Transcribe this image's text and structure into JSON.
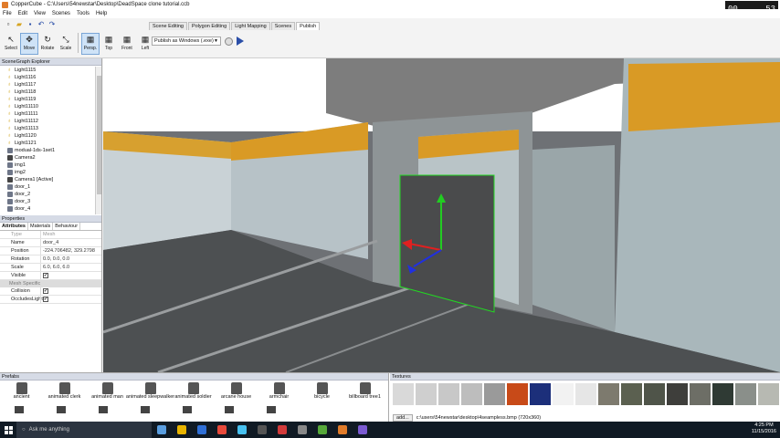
{
  "window": {
    "title": "CopperCube - C:\\Users\\54newstar\\Desktop\\DeadSpace clone tutorial.ccb"
  },
  "menu": [
    "File",
    "Edit",
    "View",
    "Scenes",
    "Tools",
    "Help"
  ],
  "clock_widget": {
    "left": "00",
    "right": "53"
  },
  "tools": [
    {
      "label": "Select",
      "icon": "↖"
    },
    {
      "label": "Move",
      "icon": "✥"
    },
    {
      "label": "Rotate",
      "icon": "↻"
    },
    {
      "label": "Scale",
      "icon": "⤡"
    }
  ],
  "views": [
    {
      "label": "Persp."
    },
    {
      "label": "Top"
    },
    {
      "label": "Front"
    },
    {
      "label": "Left"
    }
  ],
  "ribbon_tabs": [
    "Scene Editing",
    "Polygon Editing",
    "Light Mapping",
    "Scenes",
    "Publish"
  ],
  "active_ribbon_tab": "Publish",
  "publish_target": "Publish as Windows (.exe)",
  "scenegraph": {
    "title": "SceneGraph Explorer",
    "items": [
      {
        "label": "Light1115",
        "kind": "light"
      },
      {
        "label": "Light1116",
        "kind": "light"
      },
      {
        "label": "Light1117",
        "kind": "light"
      },
      {
        "label": "Light1118",
        "kind": "light"
      },
      {
        "label": "Light1119",
        "kind": "light"
      },
      {
        "label": "Light11110",
        "kind": "light"
      },
      {
        "label": "Light11111",
        "kind": "light"
      },
      {
        "label": "Light11112",
        "kind": "light"
      },
      {
        "label": "Light11113",
        "kind": "light"
      },
      {
        "label": "Light1120",
        "kind": "light"
      },
      {
        "label": "Light1121",
        "kind": "light"
      },
      {
        "label": "modual-1ds-1set1",
        "kind": "mesh"
      },
      {
        "label": "Camera2",
        "kind": "cam"
      },
      {
        "label": "img1",
        "kind": "mesh"
      },
      {
        "label": "img2",
        "kind": "mesh"
      },
      {
        "label": "Camera1 [Active]",
        "kind": "cam"
      },
      {
        "label": "door_1",
        "kind": "mesh"
      },
      {
        "label": "door_2",
        "kind": "mesh"
      },
      {
        "label": "door_3",
        "kind": "mesh"
      },
      {
        "label": "door_4",
        "kind": "mesh"
      }
    ]
  },
  "properties": {
    "title": "Properties",
    "tabs": [
      "Attributes",
      "Materials",
      "Behaviour"
    ],
    "rows": [
      {
        "key": "Type",
        "value": "Mesh",
        "dim": true
      },
      {
        "key": "Name",
        "value": "door_4"
      },
      {
        "key": "Position",
        "value": "-224.706482, 329.2798"
      },
      {
        "key": "Rotation",
        "value": "0.0, 0.0, 0.0"
      },
      {
        "key": "Scale",
        "value": "6.0, 6.0, 6.0"
      },
      {
        "key": "Visible",
        "value": "✔",
        "check": true
      }
    ],
    "section": "Mesh Specific",
    "section_rows": [
      {
        "key": "Collision",
        "value": "✔",
        "check": true
      },
      {
        "key": "OccludesLight",
        "value": "✔",
        "check": true
      }
    ]
  },
  "prefabs": {
    "title": "Prefabs",
    "items": [
      "ancient",
      "animated clerk",
      "animated man",
      "animated sleepwalker",
      "animated soldier",
      "arcane house",
      "armchair",
      "bicycle",
      "billboard tree1"
    ]
  },
  "textures": {
    "title": "Textures",
    "add_label": "add...",
    "path": "c:\\users\\54newstar\\desktop\\4seampless.bmp (720x360)",
    "swatches": [
      "#d9d9d9",
      "#cfcfcf",
      "#c8c8c8",
      "#bdbdbd",
      "#9a9a9a",
      "#c84a18",
      "#1c2f7a",
      "#f2f2f2",
      "#e6e6e6",
      "#7d7a6e",
      "#5b6050",
      "#4f5449",
      "#3e3e3b",
      "#6d6e66",
      "#2f3a34",
      "#8a8f8a",
      "#b7b9b2"
    ]
  },
  "taskbar": {
    "search_placeholder": "Ask me anything",
    "time": "4:25 PM",
    "date": "11/15/2016",
    "app_colors": [
      "#5a9ee0",
      "#e8b400",
      "#2f6fd6",
      "#e84a3b",
      "#47c1f0",
      "#555555",
      "#d23b3b",
      "#888888",
      "#56a83a",
      "#e07b2a",
      "#7a5ad1"
    ]
  }
}
